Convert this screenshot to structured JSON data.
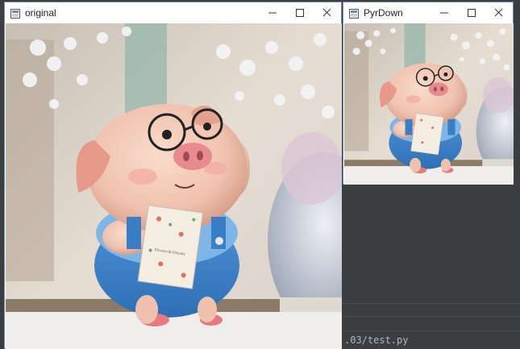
{
  "windows": {
    "original": {
      "title": "original"
    },
    "pyrdown": {
      "title": "PyrDown"
    }
  },
  "ide": {
    "terminal_text": ".03/test.py"
  },
  "photo": {
    "subject": "cartoon pig with glasses holding a notebook",
    "notebook_text": "Flowers & Dreams"
  },
  "colors": {
    "window_border": "#6b8fb3",
    "titlebar": "#ffffff",
    "ide_background": "#3c3f41"
  },
  "icons": {
    "app": "opencv-window-icon",
    "minimize": "minimize-icon",
    "maximize": "maximize-icon",
    "close": "close-icon"
  }
}
